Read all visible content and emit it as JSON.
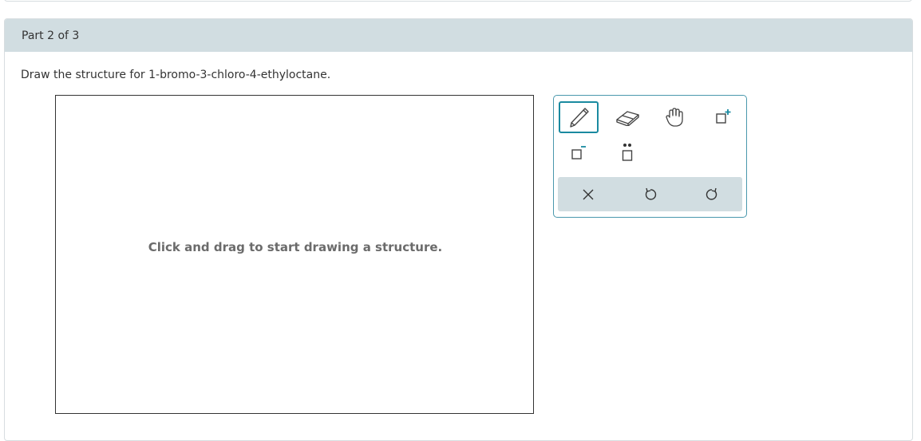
{
  "part": {
    "title": "Part 2 of 3"
  },
  "question": {
    "text": "Draw the structure for 1-bromo-3-chloro-4-ethyloctane."
  },
  "canvas": {
    "hint": "Click and drag to start drawing a structure."
  },
  "toolbar": {
    "tools": [
      {
        "name": "pencil-tool",
        "icon": "pencil-icon",
        "selected": true
      },
      {
        "name": "eraser-tool",
        "icon": "eraser-icon",
        "selected": false
      },
      {
        "name": "pan-tool",
        "icon": "hand-icon",
        "selected": false
      },
      {
        "name": "positive-charge-tool",
        "icon": "plus-charge-icon",
        "selected": false
      },
      {
        "name": "negative-charge-tool",
        "icon": "minus-charge-icon",
        "selected": false
      },
      {
        "name": "lone-pair-tool",
        "icon": "lone-pair-icon",
        "selected": false
      }
    ],
    "actions": [
      {
        "name": "clear-button",
        "icon": "close-icon"
      },
      {
        "name": "undo-button",
        "icon": "undo-icon"
      },
      {
        "name": "redo-button",
        "icon": "redo-icon"
      }
    ]
  },
  "colors": {
    "header_bg": "#d1dde1",
    "accent": "#1a8aa0",
    "toolbar_border": "#4a98ad",
    "hint_text": "#6b6b6b",
    "negative_charge": "#1a8aa0",
    "positive_charge": "#1a8aa0"
  }
}
